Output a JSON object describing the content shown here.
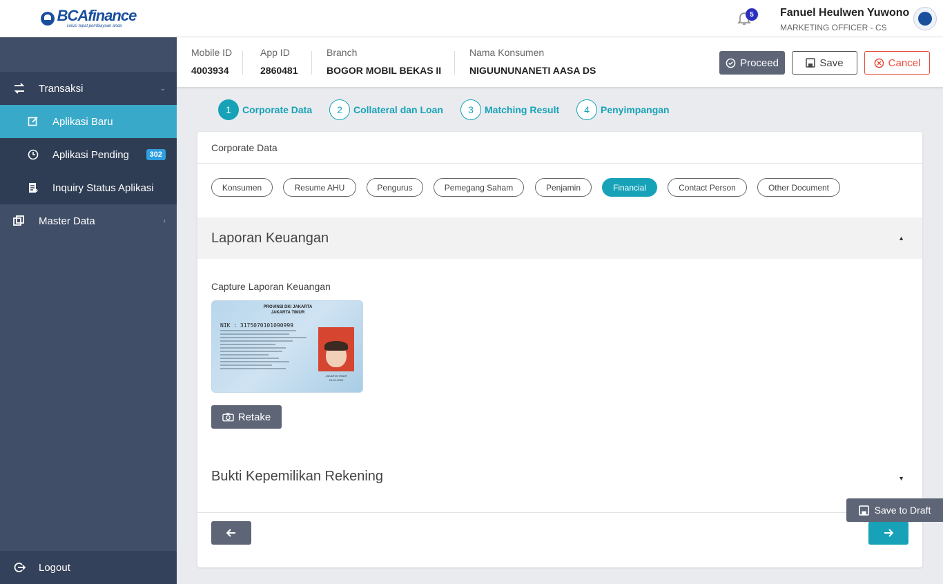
{
  "brand": {
    "name": "BCAfinance",
    "tagline": "solusi tepat pembiayaan anda"
  },
  "sidebar": {
    "items": [
      {
        "label": "Transaksi",
        "icon": "transfer-icon"
      },
      {
        "label": "Aplikasi Baru",
        "icon": "edit-icon",
        "active": true
      },
      {
        "label": "Aplikasi Pending",
        "icon": "clock-icon",
        "badge": "302"
      },
      {
        "label": "Inquiry Status Aplikasi",
        "icon": "document-icon"
      },
      {
        "label": "Master Data",
        "icon": "copy-icon"
      }
    ],
    "logout": "Logout"
  },
  "header": {
    "notifications": "5",
    "user_name": "Fanuel Heulwen Yuwono",
    "user_role": "MARKETING OFFICER - CS"
  },
  "info": {
    "mobile_id_label": "Mobile ID",
    "mobile_id": "4003934",
    "app_id_label": "App ID",
    "app_id": "2860481",
    "branch_label": "Branch",
    "branch": "BOGOR MOBIL BEKAS II",
    "consumer_label": "Nama Konsumen",
    "consumer": "NIGUUNUNANETI AASA DS"
  },
  "actions": {
    "proceed": "Proceed",
    "save": "Save",
    "cancel": "Cancel"
  },
  "steps": [
    {
      "num": "1",
      "label": "Corporate Data"
    },
    {
      "num": "2",
      "label": "Collateral dan Loan"
    },
    {
      "num": "3",
      "label": "Matching Result"
    },
    {
      "num": "4",
      "label": "Penyimpangan"
    }
  ],
  "card": {
    "title": "Corporate Data",
    "tabs": [
      "Konsumen",
      "Resume AHU",
      "Pengurus",
      "Pemegang Saham",
      "Penjamin",
      "Financial",
      "Contact Person",
      "Other Document"
    ],
    "active_tab": "Financial",
    "section1": "Laporan Keuangan",
    "capture_label": "Capture Laporan Keuangan",
    "retake": "Retake",
    "section2": "Bukti Kepemilikan Rekening"
  },
  "ktp": {
    "province": "PROVINSI DKI JAKARTA",
    "city": "JAKARTA TIMUR",
    "nik": "NIK : 3175070101090999",
    "place": "JAKARTA TIMUR",
    "date": "01-01-2020"
  },
  "draft": "Save to Draft",
  "colors": {
    "accent": "#17a2b8",
    "sidebar": "#404e67",
    "active_nav": "#39a9c9",
    "danger": "#e74c3c"
  }
}
